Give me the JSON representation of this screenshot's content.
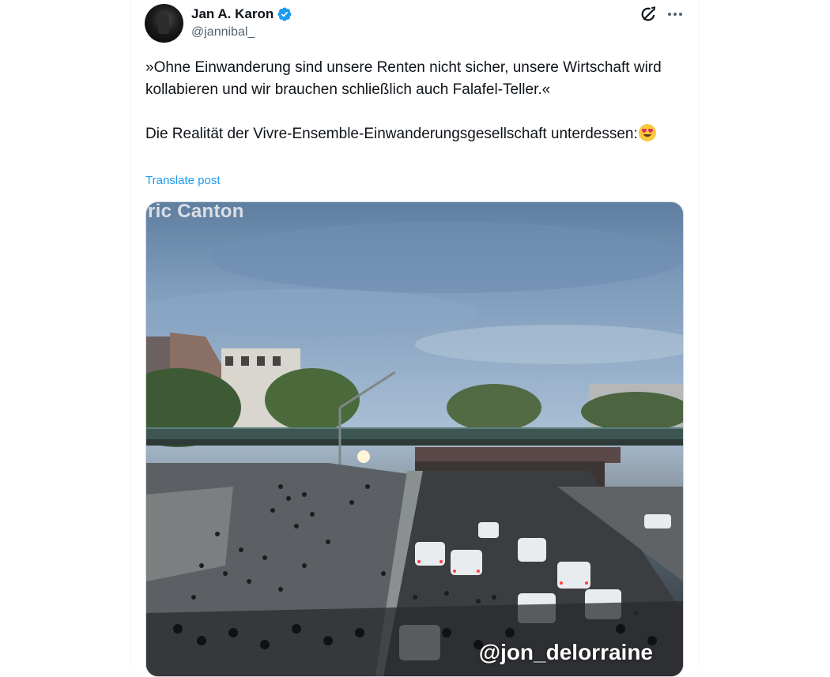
{
  "author": {
    "name": "Jan A. Karon",
    "handle": "@jannibal_",
    "verified": true,
    "verified_color": "#1d9bf0"
  },
  "header_icons": [
    "grok-icon",
    "more-icon"
  ],
  "post": {
    "line1": "»Ohne Einwanderung sind unsere Renten nicht sicher, unsere Wirtschaft wird kollabieren und wir brauchen schließlich auch Falafel-Teller.«",
    "line2": "Die Realität der Vivre-Ensemble-Einwanderungsgesellschaft unterdessen:",
    "emoji": "smiling-face-with-heart-eyes",
    "translate_label": "Translate post"
  },
  "media": {
    "watermark_top": "ric Canton",
    "watermark_bottom": "@jon_delorraine"
  },
  "colors": {
    "text": "#0f1419",
    "secondary": "#536471",
    "link": "#1d9bf0"
  }
}
